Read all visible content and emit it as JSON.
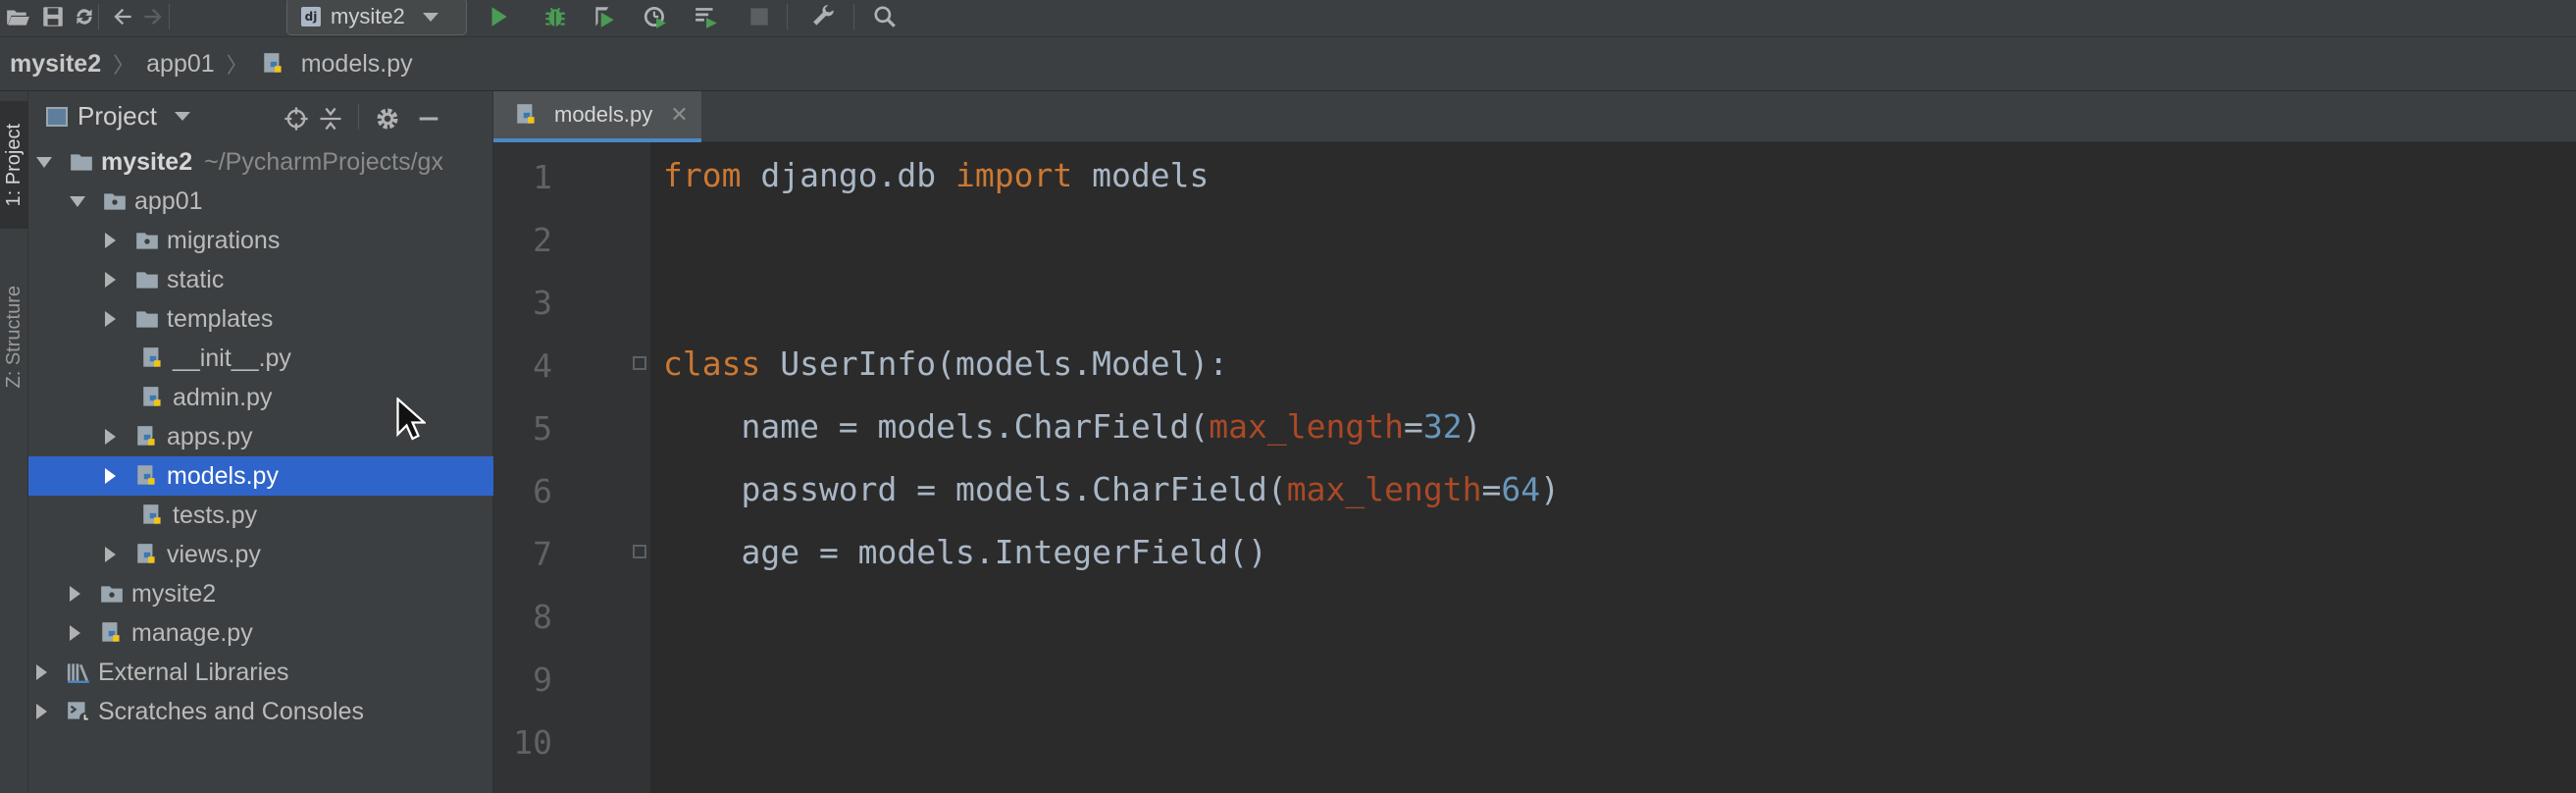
{
  "toolbar": {
    "run_configuration": "mysite2",
    "config_badge": "dj"
  },
  "breadcrumb": [
    "mysite2",
    "app01",
    "models.py"
  ],
  "tool_strip": {
    "project_tab": "1: Project",
    "structure_tab": "Z: Structure"
  },
  "project_panel": {
    "title": "Project",
    "tree": [
      {
        "label": "mysite2",
        "suffix": "~/PycharmProjects/gx"
      },
      {
        "label": "app01"
      },
      {
        "label": "migrations"
      },
      {
        "label": "static"
      },
      {
        "label": "templates"
      },
      {
        "label": "__init__.py"
      },
      {
        "label": "admin.py"
      },
      {
        "label": "apps.py"
      },
      {
        "label": "models.py"
      },
      {
        "label": "tests.py"
      },
      {
        "label": "views.py"
      },
      {
        "label": "mysite2"
      },
      {
        "label": "manage.py"
      },
      {
        "label": "External Libraries"
      },
      {
        "label": "Scratches and Consoles"
      }
    ]
  },
  "editor": {
    "tab_label": "models.py",
    "line_numbers": [
      "1",
      "2",
      "3",
      "4",
      "5",
      "6",
      "7",
      "8",
      "9",
      "10"
    ],
    "code": {
      "l1": {
        "from": "from",
        "mod": " django.db ",
        "import": "import",
        "rest": " models"
      },
      "l4": {
        "class": "class",
        "rest": " UserInfo(models.Model):"
      },
      "l5": {
        "pre": "    name = models.CharField(",
        "kw": "max_length",
        "eq": "=",
        "num": "32",
        "post": ")"
      },
      "l6": {
        "pre": "    password = models.CharField(",
        "kw": "max_length",
        "eq": "=",
        "num": "64",
        "post": ")"
      },
      "l7": {
        "text": "    age = models.IntegerField()"
      }
    }
  },
  "colors": {
    "keyword": "#cc7832",
    "parameter": "#aa4926",
    "number": "#6897bb",
    "selection": "#2f65ca"
  }
}
